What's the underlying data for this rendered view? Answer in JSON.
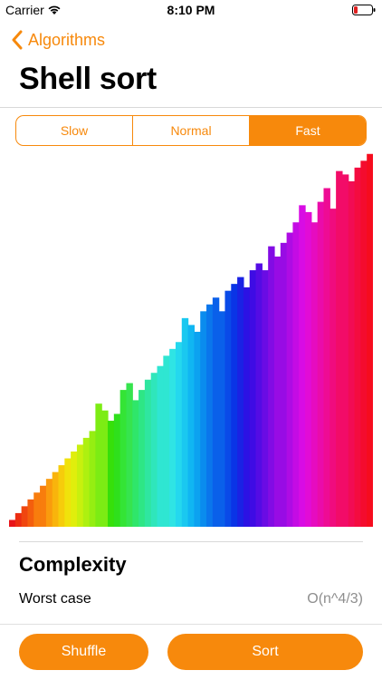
{
  "status_bar": {
    "carrier": "Carrier",
    "time": "8:10 PM",
    "battery_color": "#e02020"
  },
  "nav": {
    "back_label": "Algorithms",
    "title": "Shell sort"
  },
  "speed_control": {
    "options": [
      "Slow",
      "Normal",
      "Fast"
    ],
    "selected": "Fast"
  },
  "colors": {
    "accent": "#f7890c"
  },
  "chart_data": {
    "type": "bar",
    "title": "",
    "values": [
      2,
      4,
      6,
      8,
      10,
      12,
      14,
      16,
      18,
      20,
      22,
      24,
      26,
      28,
      36,
      34,
      31,
      33,
      40,
      42,
      37,
      40,
      43,
      45,
      47,
      50,
      52,
      54,
      61,
      59,
      57,
      63,
      65,
      67,
      63,
      69,
      71,
      73,
      70,
      75,
      77,
      75,
      82,
      79,
      83,
      86,
      89,
      94,
      92,
      89,
      95,
      99,
      93,
      104,
      103,
      101,
      105,
      107,
      109
    ],
    "colors": [
      "#e8141a",
      "#ec2d12",
      "#f0460f",
      "#f45e0d",
      "#f87d0d",
      "#fa9b0d",
      "#f9b40c",
      "#f6cc0b",
      "#f0e20b",
      "#e0ee0c",
      "#c8f00e",
      "#aef010",
      "#95ee12",
      "#7cec14",
      "#36e00a",
      "#2fe01c",
      "#34e435",
      "#36e44e",
      "#2fe66a",
      "#2ee685",
      "#2fe6a0",
      "#2fe6bb",
      "#2fe6d2",
      "#2fe4e4",
      "#24d8ee",
      "#1ac8f0",
      "#10b6f2",
      "#0ca2f0",
      "#0a8cee",
      "#0a76ec",
      "#0a60ea",
      "#0a4ae8",
      "#0a34e6",
      "#1a22e4",
      "#2c12e4",
      "#3e0ce4",
      "#540ce4",
      "#6a0ce4",
      "#820ce4",
      "#980ce4",
      "#ae0ce4",
      "#c40ce4",
      "#d80ce4",
      "#e20cd6",
      "#e60cc0",
      "#ea0caa",
      "#ee0c94",
      "#f00c7e",
      "#f20c68",
      "#f20c54",
      "#f40c40",
      "#f40c2e",
      "#f60c1e"
    ],
    "ylim": [
      0,
      110
    ]
  },
  "complexity": {
    "title": "Complexity",
    "rows": [
      {
        "label": "Worst case",
        "value": "O(n^4/3)"
      }
    ]
  },
  "actions": {
    "shuffle_label": "Shuffle",
    "sort_label": "Sort"
  }
}
